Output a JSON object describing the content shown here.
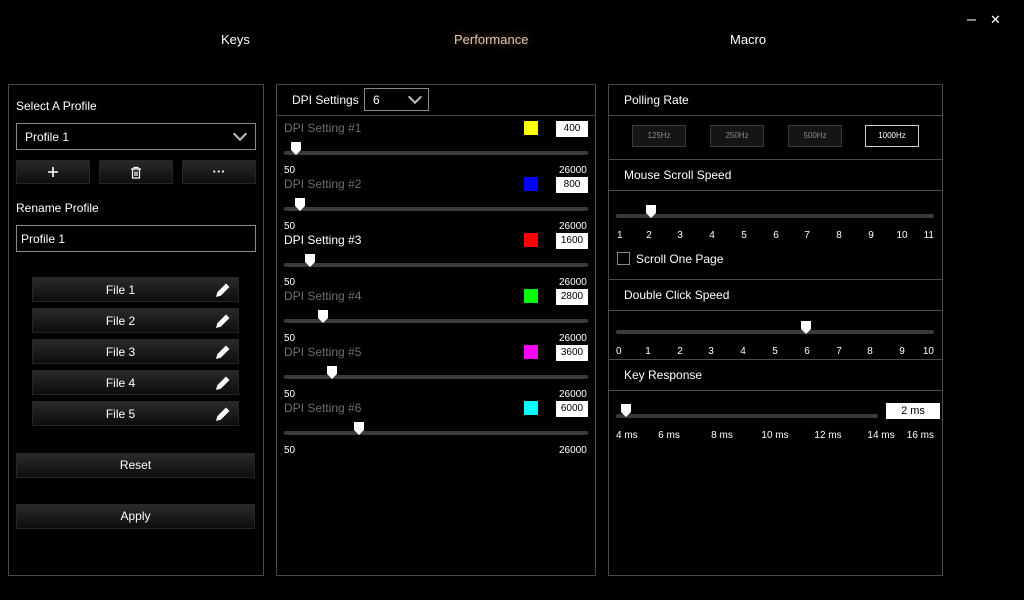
{
  "tabs": [
    "Keys",
    "Performance",
    "Macro"
  ],
  "window": {
    "minimize": "–",
    "close": "✕"
  },
  "profile": {
    "select_label": "Select A Profile",
    "selected": "Profile 1",
    "rename_label": "Rename Profile",
    "rename_value": "Profile 1",
    "add_icon": "plus-icon",
    "delete_icon": "trash-icon",
    "more_label": "···",
    "files": [
      "File 1",
      "File 2",
      "File 3",
      "File 4",
      "File 5"
    ],
    "reset": "Reset",
    "apply": "Apply"
  },
  "dpi": {
    "title": "DPI Settings",
    "count": "6",
    "min_label": "50",
    "max_label": "26000",
    "min": 50,
    "max": 26000,
    "settings": [
      {
        "label": "DPI Setting #1",
        "value": "400",
        "color": "#ffff00",
        "active": false
      },
      {
        "label": "DPI Setting #2",
        "value": "800",
        "color": "#0000ff",
        "active": false
      },
      {
        "label": "DPI Setting #3",
        "value": "1600",
        "color": "#ff0000",
        "active": true
      },
      {
        "label": "DPI Setting #4",
        "value": "2800",
        "color": "#00ff00",
        "active": false
      },
      {
        "label": "DPI Setting #5",
        "value": "3600",
        "color": "#ff00ff",
        "active": false
      },
      {
        "label": "DPI Setting #6",
        "value": "6000",
        "color": "#00ffff",
        "active": false
      }
    ]
  },
  "polling": {
    "title": "Polling Rate",
    "options": [
      "125Hz",
      "250Hz",
      "500Hz",
      "1000Hz"
    ],
    "selected": "1000Hz"
  },
  "scroll": {
    "title": "Mouse Scroll Speed",
    "ticks": [
      "1",
      "2",
      "3",
      "4",
      "5",
      "6",
      "7",
      "8",
      "9",
      "10",
      "11"
    ],
    "value": 2,
    "min": 1,
    "max": 11,
    "checkbox_label": "Scroll One Page",
    "checked": false
  },
  "double_click": {
    "title": "Double Click Speed",
    "ticks": [
      "0",
      "1",
      "2",
      "3",
      "4",
      "5",
      "6",
      "7",
      "8",
      "9",
      "10"
    ],
    "value": 6,
    "min": 0,
    "max": 10
  },
  "key_response": {
    "title": "Key Response",
    "value_text": "2 ms",
    "value": 0,
    "ticks": [
      "4 ms",
      "6 ms",
      "8 ms",
      "10 ms",
      "12 ms",
      "14 ms",
      "16 ms"
    ]
  }
}
